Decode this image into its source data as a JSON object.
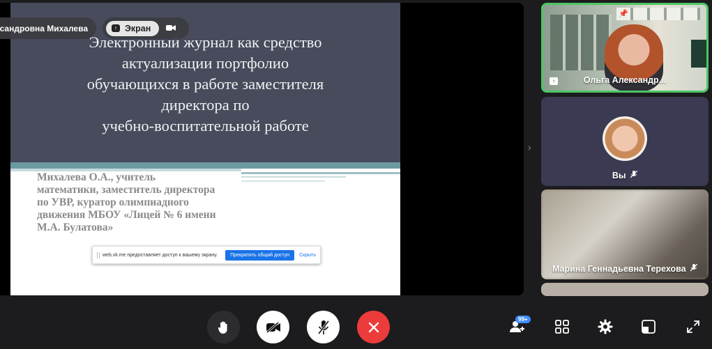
{
  "slide": {
    "title_lines": [
      "Электронный журнал как средство",
      "актуализации портфолио",
      "обучающихся в работе заместителя",
      "директора по",
      "учебно-воспитательной работе"
    ],
    "author_lines": [
      "Михалева О.А., учитель",
      "математики, заместитель директора",
      "по УВР, куратор олимпиадного",
      "движения МБОУ «Лицей № 6 имени",
      "М.А. Булатова»"
    ]
  },
  "share_bar": {
    "text": "web.vk.me предоставляет доступ к вашему экрану.",
    "stop_label": "Прекратить общий доступ",
    "hide_label": "Скрыть"
  },
  "presenter": {
    "name": "сандровна Михалева",
    "screen_label": "Экран"
  },
  "participants": [
    {
      "name": "Ольга Александр..."
    },
    {
      "name": "Вы"
    },
    {
      "name": "Марина Геннадьевна Терехова"
    }
  ],
  "toolbar": {
    "participants_badge": "99+"
  },
  "colors": {
    "end_call": "#ec3b3b",
    "active_speaker_border": "#4cc765",
    "slide_header": "#474b5c",
    "badge": "#3f8cff"
  }
}
